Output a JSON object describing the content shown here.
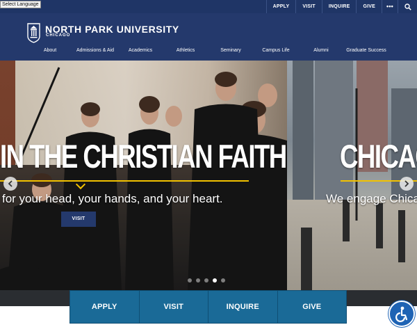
{
  "language_selector": {
    "label": "Select Language"
  },
  "utility_nav": {
    "links": [
      "APPLY",
      "VISIT",
      "INQUIRE",
      "GIVE"
    ],
    "more_label": "•••",
    "search_icon": "search-icon"
  },
  "brand": {
    "name": "NORTH PARK UNIVERSITY",
    "subtitle": "CHICAGO",
    "logo_icon": "shield-crest-icon"
  },
  "main_nav": {
    "items": [
      "About",
      "Admissions & Aid",
      "Academics",
      "Athletics",
      "Seminary",
      "Campus Life",
      "Alumni",
      "Graduate Success"
    ]
  },
  "hero": {
    "headline": "IN THE CHRISTIAN FAITH",
    "tagline": "for your head, your hands, and your heart.",
    "cta_label": "VISIT",
    "next_headline": "CHICAG",
    "next_tagline": "We engage Chica",
    "prev_icon": "chevron-left-icon",
    "next_icon": "chevron-right-icon",
    "slide_count": 5,
    "active_slide": 4
  },
  "quick_links": [
    "APPLY",
    "VISIT",
    "INQUIRE",
    "GIVE"
  ],
  "accessibility": {
    "icon": "accessibility-icon"
  },
  "colors": {
    "navy": "#24396c",
    "utility_navy": "#1f3566",
    "gold": "#f2c200",
    "quick_link_blue": "#1a6a97",
    "a11y_blue": "#1e63b4"
  }
}
